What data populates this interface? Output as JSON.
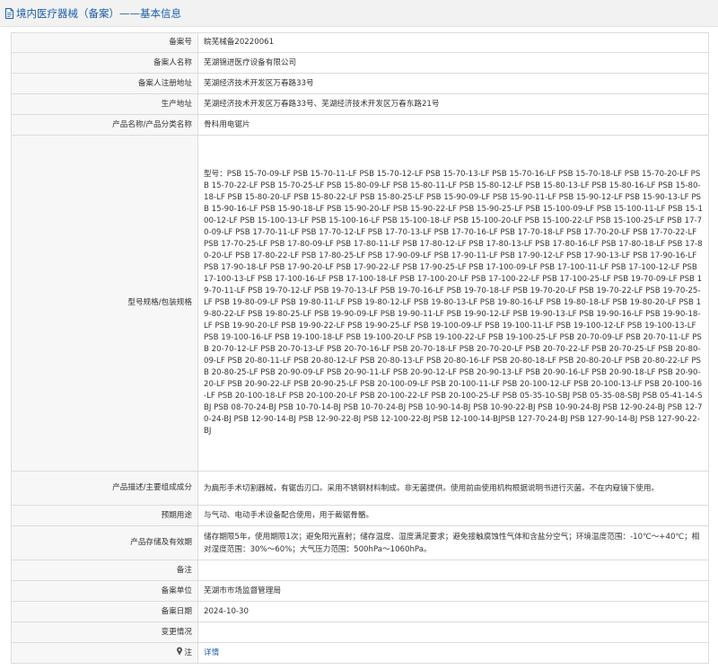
{
  "header": {
    "title": "境内医疗器械（备案）——基本信息"
  },
  "colors": {
    "title": "#1c5ea6",
    "link": "#1c5ea6",
    "label_bg": "#f7f7f7",
    "border": "#dcdcdc"
  },
  "rows": {
    "record_no": {
      "label": "备案号",
      "value": "皖芜械备20220061"
    },
    "registrant_name": {
      "label": "备案人名称",
      "value": "芜湖锦进医疗设备有限公司"
    },
    "registrant_address": {
      "label": "备案人注册地址",
      "value": "芜湖经济技术开发区万春路33号"
    },
    "production_address": {
      "label": "生产地址",
      "value": "芜湖经济技术开发区万春路33号、芜湖经济技术开发区万春东路21号"
    },
    "product_name": {
      "label": "产品名称/产品分类名称",
      "value": "骨科用电锯片"
    },
    "models": {
      "label": "型号规格/包装规格",
      "value": "型号：PSB 15-70-09-LF PSB 15-70-11-LF PSB 15-70-12-LF PSB 15-70-13-LF PSB 15-70-16-LF PSB 15-70-18-LF PSB 15-70-20-LF PSB 15-70-22-LF PSB 15-70-25-LF PSB 15-80-09-LF PSB 15-80-11-LF PSB 15-80-12-LF PSB 15-80-13-LF PSB 15-80-16-LF PSB 15-80-18-LF PSB 15-80-20-LF PSB 15-80-22-LF PSB 15-80-25-LF PSB 15-90-09-LF PSB 15-90-11-LF PSB 15-90-12-LF PSB 15-90-13-LF PSB 15-90-16-LF PSB 15-90-18-LF PSB 15-90-20-LF PSB 15-90-22-LF PSB 15-90-25-LF PSB 15-100-09-LF PSB 15-100-11-LF PSB 15-100-12-LF PSB 15-100-13-LF PSB 15-100-16-LF PSB 15-100-18-LF PSB 15-100-20-LF PSB 15-100-22-LF PSB 15-100-25-LF PSB 17-70-09-LF PSB 17-70-11-LF PSB 17-70-12-LF PSB 17-70-13-LF PSB 17-70-16-LF PSB 17-70-18-LF PSB 17-70-20-LF PSB 17-70-22-LF PSB 17-70-25-LF PSB 17-80-09-LF PSB 17-80-11-LF PSB 17-80-12-LF PSB 17-80-13-LF PSB 17-80-16-LF PSB 17-80-18-LF PSB 17-80-20-LF PSB 17-80-22-LF PSB 17-80-25-LF PSB 17-90-09-LF PSB 17-90-11-LF PSB 17-90-12-LF PSB 17-90-13-LF PSB 17-90-16-LF PSB 17-90-18-LF PSB 17-90-20-LF PSB 17-90-22-LF PSB 17-90-25-LF PSB 17-100-09-LF PSB 17-100-11-LF PSB 17-100-12-LF PSB 17-100-13-LF PSB 17-100-16-LF PSB 17-100-18-LF PSB 17-100-20-LF PSB 17-100-22-LF PSB 17-100-25-LF PSB 19-70-09-LF PSB 19-70-11-LF PSB 19-70-12-LF PSB 19-70-13-LF PSB 19-70-16-LF PSB 19-70-18-LF PSB 19-70-20-LF PSB 19-70-22-LF PSB 19-70-25-LF PSB 19-80-09-LF PSB 19-80-11-LF PSB 19-80-12-LF PSB 19-80-13-LF PSB 19-80-16-LF PSB 19-80-18-LF PSB 19-80-20-LF PSB 19-80-22-LF PSB 19-80-25-LF PSB 19-90-09-LF PSB 19-90-11-LF PSB 19-90-12-LF PSB 19-90-13-LF PSB 19-90-16-LF PSB 19-90-18-LF PSB 19-90-20-LF PSB 19-90-22-LF PSB 19-90-25-LF PSB 19-100-09-LF PSB 19-100-11-LF PSB 19-100-12-LF PSB 19-100-13-LF PSB 19-100-16-LF PSB 19-100-18-LF PSB 19-100-20-LF PSB 19-100-22-LF PSB 19-100-25-LF PSB 20-70-09-LF PSB 20-70-11-LF PSB 20-70-12-LF PSB 20-70-13-LF PSB 20-70-16-LF PSB 20-70-18-LF PSB 20-70-20-LF PSB 20-70-22-LF PSB 20-70-25-LF PSB 20-80-09-LF PSB 20-80-11-LF PSB 20-80-12-LF PSB 20-80-13-LF PSB 20-80-16-LF PSB 20-80-18-LF PSB 20-80-20-LF PSB 20-80-22-LF PSB 20-80-25-LF PSB 20-90-09-LF PSB 20-90-11-LF PSB 20-90-12-LF PSB 20-90-13-LF PSB 20-90-16-LF PSB 20-90-18-LF PSB 20-90-20-LF PSB 20-90-22-LF PSB 20-90-25-LF PSB 20-100-09-LF PSB 20-100-11-LF PSB 20-100-12-LF PSB 20-100-13-LF PSB 20-100-16-LF PSB 20-100-18-LF PSB 20-100-20-LF PSB 20-100-22-LF PSB 20-100-25-LF PSB 05-35-10-SBJ PSB 05-35-08-SBJ PSB 05-41-14-SBJ PSB 08-70-24-BJ PSB 10-70-14-BJ PSB 10-70-24-BJ PSB 10-90-14-BJ PSB 10-90-22-BJ PSB 10-90-24-BJ PSB 12-90-24-BJ PSB 12-70-24-BJ PSB 12-90-14-BJ PSB 12-90-22-BJ PSB 12-100-22-BJ PSB 12-100-14-BJPSB 127-70-24-BJ PSB 127-90-14-BJ PSB 127-90-22-BJ"
    },
    "description": {
      "label": "产品描述/主要组成成分",
      "value": "为扁形手术切割器械，有锯齿刃口。采用不锈钢材料制成。非无菌提供。使用前由使用机构根据说明书进行灭菌。不在内窥镜下使用。"
    },
    "intended_use": {
      "label": "预期用途",
      "value": "与气动、电动手术设备配合使用，用于截锯骨骼。"
    },
    "storage": {
      "label": "产品存储及有效期",
      "value": "储存期限5年，使用期限1次；避免阳光直射；储存温度、湿度满足要求；避免接触腐蚀性气体和含盐分空气；环境温度范围：-10℃～+40℃；相对湿度范围：30%～60%；大气压力范围：500hPa～1060hPa。"
    },
    "remarks": {
      "label": "备注",
      "value": ""
    },
    "authority": {
      "label": "备案单位",
      "value": "芜湖市市场监督管理局"
    },
    "record_date": {
      "label": "备案日期",
      "value": "2024-10-30"
    },
    "changes": {
      "label": "变更情况",
      "value": ""
    },
    "note": {
      "label": "注",
      "icon": "pin-icon",
      "link_text": "详情"
    }
  }
}
